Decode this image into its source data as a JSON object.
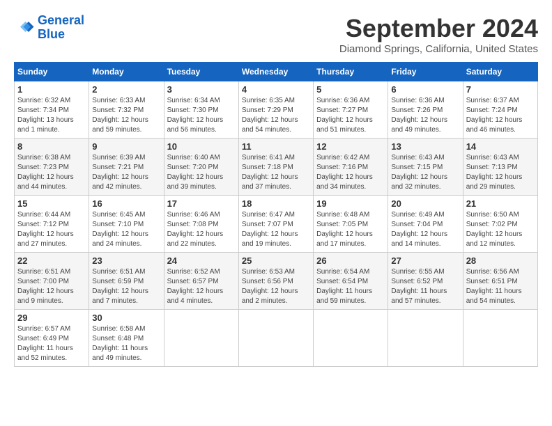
{
  "header": {
    "logo_line1": "General",
    "logo_line2": "Blue",
    "month_title": "September 2024",
    "location": "Diamond Springs, California, United States"
  },
  "calendar": {
    "weekdays": [
      "Sunday",
      "Monday",
      "Tuesday",
      "Wednesday",
      "Thursday",
      "Friday",
      "Saturday"
    ],
    "weeks": [
      [
        {
          "day": "1",
          "sunrise": "Sunrise: 6:32 AM",
          "sunset": "Sunset: 7:34 PM",
          "daylight": "Daylight: 13 hours and 1 minute."
        },
        {
          "day": "2",
          "sunrise": "Sunrise: 6:33 AM",
          "sunset": "Sunset: 7:32 PM",
          "daylight": "Daylight: 12 hours and 59 minutes."
        },
        {
          "day": "3",
          "sunrise": "Sunrise: 6:34 AM",
          "sunset": "Sunset: 7:30 PM",
          "daylight": "Daylight: 12 hours and 56 minutes."
        },
        {
          "day": "4",
          "sunrise": "Sunrise: 6:35 AM",
          "sunset": "Sunset: 7:29 PM",
          "daylight": "Daylight: 12 hours and 54 minutes."
        },
        {
          "day": "5",
          "sunrise": "Sunrise: 6:36 AM",
          "sunset": "Sunset: 7:27 PM",
          "daylight": "Daylight: 12 hours and 51 minutes."
        },
        {
          "day": "6",
          "sunrise": "Sunrise: 6:36 AM",
          "sunset": "Sunset: 7:26 PM",
          "daylight": "Daylight: 12 hours and 49 minutes."
        },
        {
          "day": "7",
          "sunrise": "Sunrise: 6:37 AM",
          "sunset": "Sunset: 7:24 PM",
          "daylight": "Daylight: 12 hours and 46 minutes."
        }
      ],
      [
        {
          "day": "8",
          "sunrise": "Sunrise: 6:38 AM",
          "sunset": "Sunset: 7:23 PM",
          "daylight": "Daylight: 12 hours and 44 minutes."
        },
        {
          "day": "9",
          "sunrise": "Sunrise: 6:39 AM",
          "sunset": "Sunset: 7:21 PM",
          "daylight": "Daylight: 12 hours and 42 minutes."
        },
        {
          "day": "10",
          "sunrise": "Sunrise: 6:40 AM",
          "sunset": "Sunset: 7:20 PM",
          "daylight": "Daylight: 12 hours and 39 minutes."
        },
        {
          "day": "11",
          "sunrise": "Sunrise: 6:41 AM",
          "sunset": "Sunset: 7:18 PM",
          "daylight": "Daylight: 12 hours and 37 minutes."
        },
        {
          "day": "12",
          "sunrise": "Sunrise: 6:42 AM",
          "sunset": "Sunset: 7:16 PM",
          "daylight": "Daylight: 12 hours and 34 minutes."
        },
        {
          "day": "13",
          "sunrise": "Sunrise: 6:43 AM",
          "sunset": "Sunset: 7:15 PM",
          "daylight": "Daylight: 12 hours and 32 minutes."
        },
        {
          "day": "14",
          "sunrise": "Sunrise: 6:43 AM",
          "sunset": "Sunset: 7:13 PM",
          "daylight": "Daylight: 12 hours and 29 minutes."
        }
      ],
      [
        {
          "day": "15",
          "sunrise": "Sunrise: 6:44 AM",
          "sunset": "Sunset: 7:12 PM",
          "daylight": "Daylight: 12 hours and 27 minutes."
        },
        {
          "day": "16",
          "sunrise": "Sunrise: 6:45 AM",
          "sunset": "Sunset: 7:10 PM",
          "daylight": "Daylight: 12 hours and 24 minutes."
        },
        {
          "day": "17",
          "sunrise": "Sunrise: 6:46 AM",
          "sunset": "Sunset: 7:08 PM",
          "daylight": "Daylight: 12 hours and 22 minutes."
        },
        {
          "day": "18",
          "sunrise": "Sunrise: 6:47 AM",
          "sunset": "Sunset: 7:07 PM",
          "daylight": "Daylight: 12 hours and 19 minutes."
        },
        {
          "day": "19",
          "sunrise": "Sunrise: 6:48 AM",
          "sunset": "Sunset: 7:05 PM",
          "daylight": "Daylight: 12 hours and 17 minutes."
        },
        {
          "day": "20",
          "sunrise": "Sunrise: 6:49 AM",
          "sunset": "Sunset: 7:04 PM",
          "daylight": "Daylight: 12 hours and 14 minutes."
        },
        {
          "day": "21",
          "sunrise": "Sunrise: 6:50 AM",
          "sunset": "Sunset: 7:02 PM",
          "daylight": "Daylight: 12 hours and 12 minutes."
        }
      ],
      [
        {
          "day": "22",
          "sunrise": "Sunrise: 6:51 AM",
          "sunset": "Sunset: 7:00 PM",
          "daylight": "Daylight: 12 hours and 9 minutes."
        },
        {
          "day": "23",
          "sunrise": "Sunrise: 6:51 AM",
          "sunset": "Sunset: 6:59 PM",
          "daylight": "Daylight: 12 hours and 7 minutes."
        },
        {
          "day": "24",
          "sunrise": "Sunrise: 6:52 AM",
          "sunset": "Sunset: 6:57 PM",
          "daylight": "Daylight: 12 hours and 4 minutes."
        },
        {
          "day": "25",
          "sunrise": "Sunrise: 6:53 AM",
          "sunset": "Sunset: 6:56 PM",
          "daylight": "Daylight: 12 hours and 2 minutes."
        },
        {
          "day": "26",
          "sunrise": "Sunrise: 6:54 AM",
          "sunset": "Sunset: 6:54 PM",
          "daylight": "Daylight: 11 hours and 59 minutes."
        },
        {
          "day": "27",
          "sunrise": "Sunrise: 6:55 AM",
          "sunset": "Sunset: 6:52 PM",
          "daylight": "Daylight: 11 hours and 57 minutes."
        },
        {
          "day": "28",
          "sunrise": "Sunrise: 6:56 AM",
          "sunset": "Sunset: 6:51 PM",
          "daylight": "Daylight: 11 hours and 54 minutes."
        }
      ],
      [
        {
          "day": "29",
          "sunrise": "Sunrise: 6:57 AM",
          "sunset": "Sunset: 6:49 PM",
          "daylight": "Daylight: 11 hours and 52 minutes."
        },
        {
          "day": "30",
          "sunrise": "Sunrise: 6:58 AM",
          "sunset": "Sunset: 6:48 PM",
          "daylight": "Daylight: 11 hours and 49 minutes."
        },
        null,
        null,
        null,
        null,
        null
      ]
    ]
  }
}
